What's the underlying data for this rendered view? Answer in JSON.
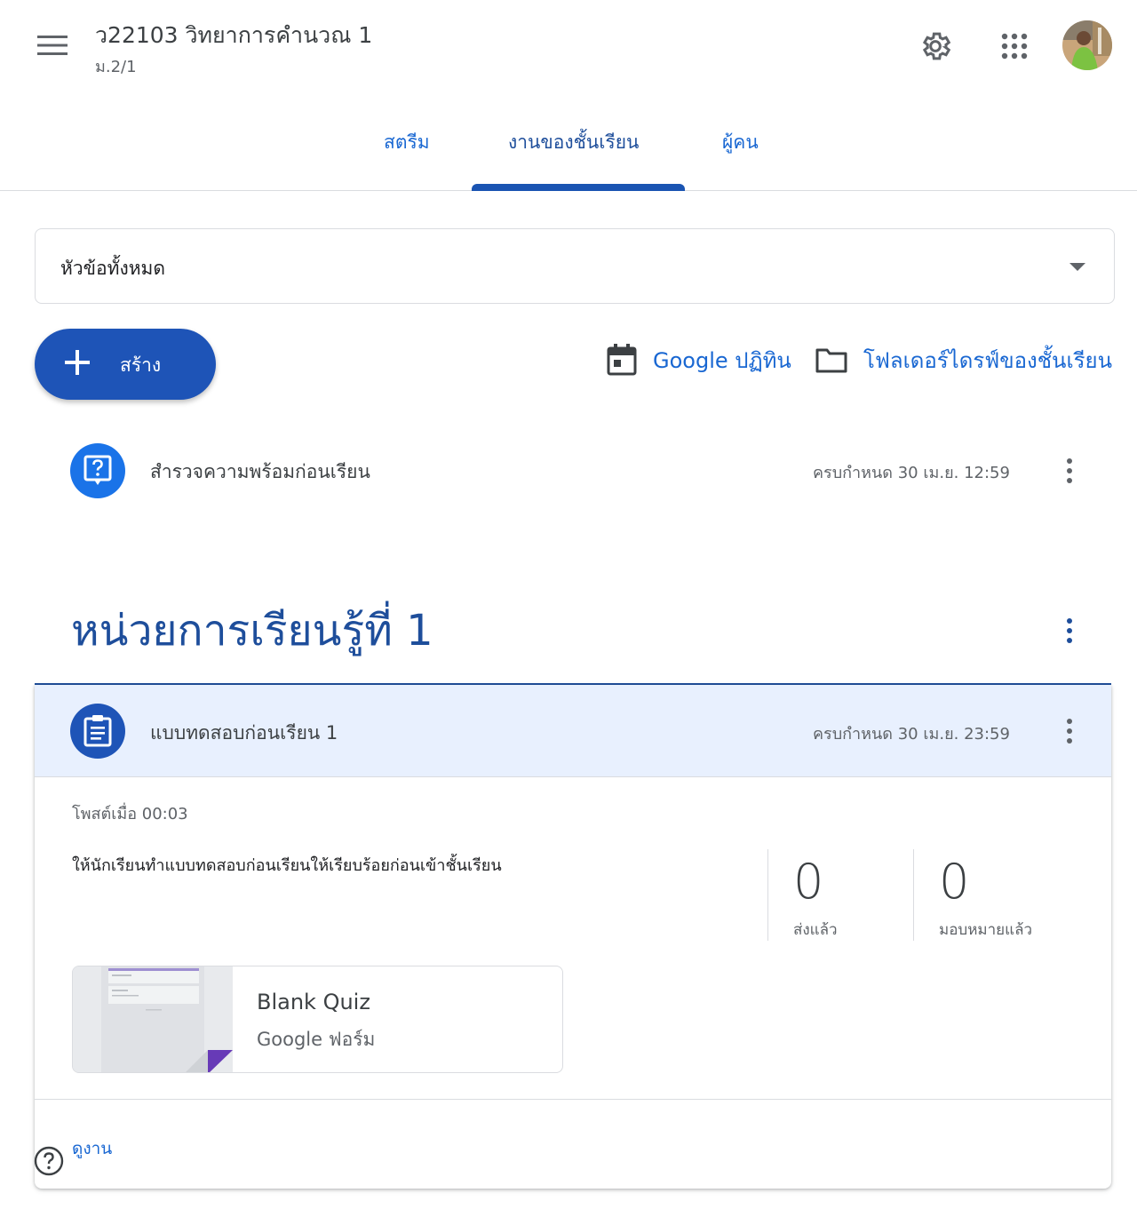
{
  "header": {
    "course_title": "ว22103 วิทยาการคำนวณ 1",
    "course_section": "ม.2/1",
    "icons": [
      "menu-icon",
      "settings-gear-icon",
      "apps-grid-icon",
      "avatar"
    ]
  },
  "tabs": [
    {
      "label": "สตรีม",
      "active": false
    },
    {
      "label": "งานของชั้นเรียน",
      "active": true
    },
    {
      "label": "ผู้คน",
      "active": false
    }
  ],
  "topic_filter": {
    "selected": "หัวข้อทั้งหมด"
  },
  "toolbar": {
    "create_label": "สร้าง",
    "calendar_link": "Google ปฏิทิน",
    "drive_link": "โฟลเดอร์ไดรฟ์ของชั้นเรียน"
  },
  "standalone_item": {
    "title": "สำรวจความพร้อมก่อนเรียน",
    "due": "ครบกำหนด 30 เม.ย. 12:59",
    "icon": "question-icon"
  },
  "topic": {
    "heading": "หน่วยการเรียนรู้ที่ 1",
    "assignment": {
      "title": "แบบทดสอบก่อนเรียน 1",
      "due": "ครบกำหนด 30 เม.ย. 23:59",
      "icon": "quiz-assignment-icon",
      "posted": "โพสต์เมื่อ 00:03",
      "instructions": "ให้นักเรียนทำแบบทดสอบก่อนเรียนให้เรียบร้อยก่อนเข้าชั้นเรียน",
      "stats": [
        {
          "value": "0",
          "label": "ส่งแล้ว"
        },
        {
          "value": "0",
          "label": "มอบหมายแล้ว"
        }
      ],
      "attachment": {
        "title": "Blank Quiz",
        "subtitle": "Google ฟอร์ม"
      },
      "view_link": "ดูงาน"
    }
  },
  "colors": {
    "primary_blue": "#1e54b7",
    "link_blue": "#1967d2",
    "heading_blue": "#1e4e9b",
    "card_header_bg": "#e8f0fe",
    "forms_purple": "#673ab7"
  }
}
